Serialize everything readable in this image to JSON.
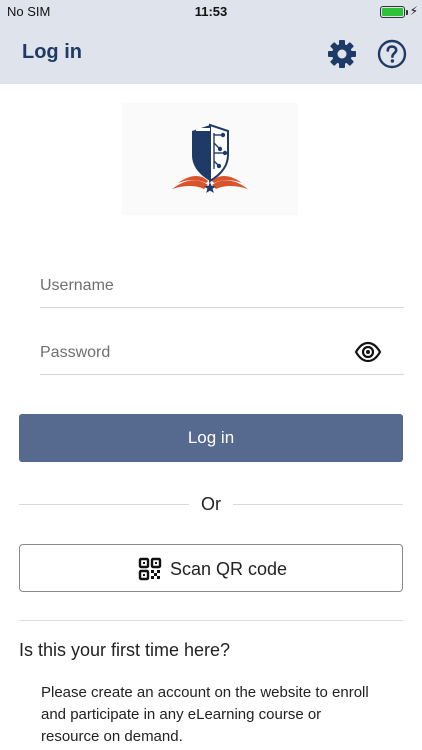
{
  "status_bar": {
    "carrier": "No SIM",
    "time": "11:53",
    "battery_level": 1.0
  },
  "header": {
    "title": "Log in",
    "settings_icon": "gear-icon",
    "help_icon": "question-circle-icon"
  },
  "form": {
    "username_placeholder": "Username",
    "username_value": "",
    "password_placeholder": "Password",
    "password_value": "",
    "show_password_icon": "eye-icon",
    "login_label": "Log in"
  },
  "divider": {
    "text": "Or"
  },
  "scan": {
    "label": "Scan QR code",
    "icon": "qr-code-icon"
  },
  "signup": {
    "heading": "Is this your first time here?",
    "text": "Please create an account on the website to enroll and participate in any eLearning course or resource on demand."
  },
  "colors": {
    "header_bg": "#dfe4ec",
    "header_title": "#1f3a66",
    "primary_button": "#56698f",
    "battery": "#2dc23a",
    "logo_navy": "#1f3a66",
    "logo_orange": "#d9532b"
  }
}
